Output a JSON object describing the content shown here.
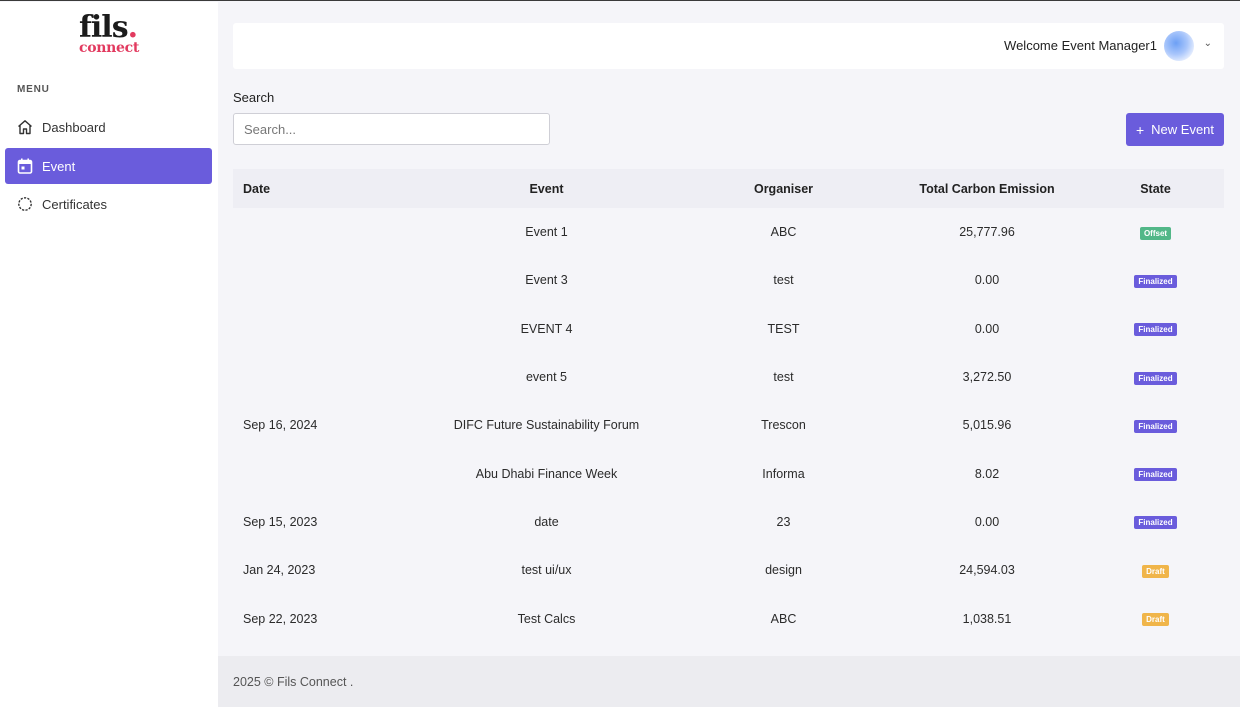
{
  "logo": {
    "top": "fils",
    "dot": ".",
    "bottom": "connect"
  },
  "sidebar": {
    "menu_label": "MENU",
    "items": [
      {
        "label": "Dashboard",
        "icon": "home-icon",
        "active": false
      },
      {
        "label": "Event",
        "icon": "calendar-icon",
        "active": true
      },
      {
        "label": "Certificates",
        "icon": "badge-icon",
        "active": false
      }
    ]
  },
  "header": {
    "welcome": "Welcome Event Manager1",
    "caret": "⌄"
  },
  "search": {
    "label": "Search",
    "placeholder": "Search..."
  },
  "actions": {
    "new_event_label": "New Event",
    "plus": "+"
  },
  "table": {
    "headers": {
      "date": "Date",
      "event": "Event",
      "organiser": "Organiser",
      "total": "Total Carbon Emission",
      "state": "State"
    },
    "rows": [
      {
        "date": "",
        "event": "Event 1",
        "organiser": "ABC",
        "total": "25,777.96",
        "state": "Offset"
      },
      {
        "date": "",
        "event": "Event 3",
        "organiser": "test",
        "total": "0.00",
        "state": "Finalized"
      },
      {
        "date": "",
        "event": "EVENT 4",
        "organiser": "TEST",
        "total": "0.00",
        "state": "Finalized"
      },
      {
        "date": "",
        "event": "event 5",
        "organiser": "test",
        "total": "3,272.50",
        "state": "Finalized"
      },
      {
        "date": "Sep 16, 2024",
        "event": "DIFC Future Sustainability Forum",
        "organiser": "Trescon",
        "total": "5,015.96",
        "state": "Finalized"
      },
      {
        "date": "",
        "event": "Abu Dhabi Finance Week",
        "organiser": "Informa",
        "total": "8.02",
        "state": "Finalized"
      },
      {
        "date": "Sep 15, 2023",
        "event": "date",
        "organiser": "23",
        "total": "0.00",
        "state": "Finalized"
      },
      {
        "date": "Jan 24, 2023",
        "event": "test ui/ux",
        "organiser": "design",
        "total": "24,594.03",
        "state": "Draft"
      },
      {
        "date": "Sep 22, 2023",
        "event": "Test Calcs",
        "organiser": "ABC",
        "total": "1,038.51",
        "state": "Draft"
      }
    ]
  },
  "state_colors": {
    "Offset": "#52b788",
    "Finalized": "#6a5cdc",
    "Draft": "#f0b54a"
  },
  "colors": {
    "accent": "#6a5cdc",
    "brand_red": "#e23a5f"
  },
  "footer": {
    "text": "2025 © Fils Connect ."
  }
}
